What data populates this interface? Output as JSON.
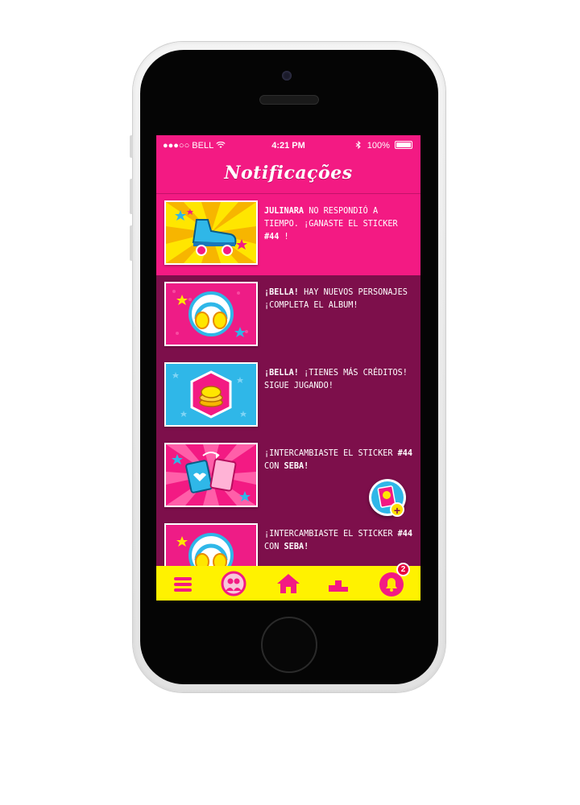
{
  "status_bar": {
    "carrier": "●●●○○ BELL",
    "time": "4:21 PM",
    "battery": "100%"
  },
  "header": {
    "title": "Notificações"
  },
  "notifications": [
    {
      "bold1": "JULINARA",
      "text1": " NO RESPONDIÓ A TIEMPO. ¡GANASTE EL STICKER ",
      "bold2": "#44",
      "text2": " !",
      "thumb_icon": "roller-skate-icon"
    },
    {
      "bold1": "¡BELLA!",
      "text1": " HAY NUEVOS PERSONAJES ¡COMPLETA EL ALBUM!",
      "bold2": "",
      "text2": "",
      "thumb_icon": "headphones-icon"
    },
    {
      "bold1": "¡BELLA!",
      "text1": " ¡TIENES MÁS CRÉDITOS! SIGUE JUGANDO!",
      "bold2": "",
      "text2": "",
      "thumb_icon": "coins-icon"
    },
    {
      "bold1": "",
      "text1": "¡INTERCAMBIASTE EL STICKER ",
      "bold2": "#44",
      "text2": " CON ",
      "bold3": "SEBA!",
      "thumb_icon": "swap-cards-icon"
    },
    {
      "bold1": "",
      "text1": "¡INTERCAMBIASTE EL STICKER ",
      "bold2": "#44",
      "text2": " CON ",
      "bold3": "SEBA!",
      "thumb_icon": "headphones-icon"
    }
  ],
  "fab": {
    "plus": "+"
  },
  "bottom_nav": {
    "badge": "2",
    "items": [
      "menu-icon",
      "friends-icon",
      "home-icon",
      "ranking-icon",
      "bell-icon"
    ]
  },
  "colors": {
    "pink": "#f31a83",
    "dark_magenta": "#7d0f4b",
    "yellow": "#fff200",
    "cyan": "#2fb7e8"
  }
}
